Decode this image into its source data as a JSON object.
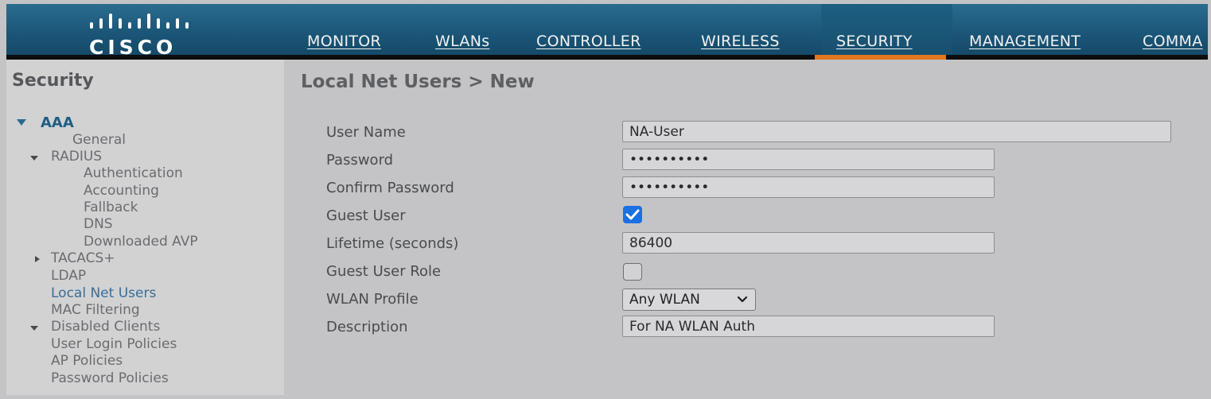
{
  "brand": {
    "logo_text": "CISCO",
    "header_color": "#1a5577",
    "active_tab_color": "#e0761e"
  },
  "nav": [
    {
      "label": "MONITOR"
    },
    {
      "label": "WLANs"
    },
    {
      "label": "CONTROLLER"
    },
    {
      "label": "WIRELESS"
    },
    {
      "label": "SECURITY",
      "active": true
    },
    {
      "label": "MANAGEMENT"
    },
    {
      "label": "COMMA"
    }
  ],
  "sidebar": {
    "title": "Security",
    "tree": {
      "aaa": "AAA",
      "general": "General",
      "radius": "RADIUS",
      "authentication": "Authentication",
      "accounting": "Accounting",
      "fallback": "Fallback",
      "dns": "DNS",
      "downloaded_avp": "Downloaded AVP",
      "tacacs": "TACACS+",
      "ldap": "LDAP",
      "local_net_users": "Local Net Users",
      "mac_filtering": "MAC Filtering",
      "disabled_clients": "Disabled Clients",
      "user_login_policies": "User Login Policies",
      "ap_policies": "AP Policies",
      "password_policies": "Password Policies"
    }
  },
  "page": {
    "title": "Local Net Users > New"
  },
  "form": {
    "user_name": {
      "label": "User Name",
      "value": "NA-User"
    },
    "password": {
      "label": "Password",
      "value": "••••••••••"
    },
    "confirm_password": {
      "label": "Confirm Password",
      "value": "••••••••••"
    },
    "guest_user": {
      "label": "Guest User",
      "checked": true
    },
    "lifetime": {
      "label": "Lifetime (seconds)",
      "value": "86400"
    },
    "guest_user_role": {
      "label": "Guest User Role",
      "checked": false
    },
    "wlan_profile": {
      "label": "WLAN Profile",
      "value": "Any WLAN"
    },
    "description": {
      "label": "Description",
      "value": "For NA WLAN Auth"
    }
  }
}
